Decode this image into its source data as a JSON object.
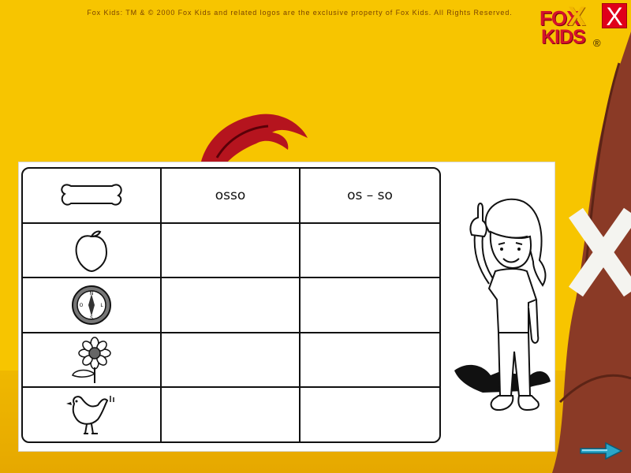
{
  "header": {
    "copyright": "Fox Kids: TM & © 2000 Fox Kids and related logos are the exclusive property of Fox Kids. All Rights Reserved.",
    "close_label": "X",
    "logo": {
      "top_text": "FOX",
      "bottom_text": "KIDS",
      "registered": "®"
    }
  },
  "worksheet": {
    "columns": [
      "",
      "osso",
      "os – so"
    ],
    "rows": [
      {
        "icon": "bone-icon",
        "cells": [
          "osso",
          "os – so"
        ]
      },
      {
        "icon": "peach-icon",
        "cells": [
          "",
          ""
        ]
      },
      {
        "icon": "compass-icon",
        "cells": [
          "",
          ""
        ]
      },
      {
        "icon": "flower-icon",
        "cells": [
          "",
          ""
        ]
      },
      {
        "icon": "bird-icon",
        "cells": [
          "",
          ""
        ]
      }
    ],
    "compass_letters": [
      "N",
      "S",
      "L",
      "O"
    ]
  },
  "navigation": {
    "next_icon": "next-arrow-icon"
  },
  "colors": {
    "background": "#f7c500",
    "close": "#e0001a",
    "logo_red": "#d4122c",
    "arrow": "#2aa6c8"
  }
}
